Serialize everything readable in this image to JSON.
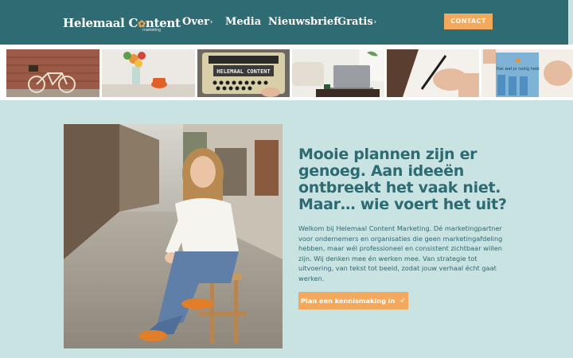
{
  "header": {
    "logo": {
      "text_before": "Helemaal C",
      "flower_glyph": "✿",
      "text_after": "ntent",
      "subtitle": "marketing"
    },
    "nav": [
      {
        "label": "Over",
        "has_dropdown": true,
        "icon": "chevron-down-icon"
      },
      {
        "label": "Media",
        "has_dropdown": false
      },
      {
        "label": "Nieuwsbrief",
        "has_dropdown": false
      },
      {
        "label": "Gratis",
        "has_dropdown": true,
        "icon": "chevron-down-icon"
      }
    ],
    "contact_label": "CONTACT"
  },
  "strip": {
    "images": [
      "bicycle-photo",
      "flowers-phone-photo",
      "typewriter-photo",
      "laptop-photo",
      "writing-hand-photo",
      "brochure-photo"
    ],
    "typewriter_text": "HELEMAAL CONTENT",
    "brochure_text": "Pak wat je nodig hebt"
  },
  "hero": {
    "image": "woman-on-stool-in-street-photo",
    "title": "Mooie plannen zijn er genoeg. Aan ideeën ontbreekt het vaak niet. Maar… wie voert het uit?",
    "body": "Welkom bij Helemaal Content Marketing. Dé marketingpartner voor ondernemers en organisaties die geen marketingafdeling hebben, maar wél professioneel en consistent zichtbaar willen zijn. Wij denken mee én werken mee. Van strategie tot uitvoering, van tekst tot beeld, zodat jouw verhaal écht gaat werken.",
    "cta_label": "Plan een kennismaking in",
    "cta_icon": "paper-plane-icon"
  },
  "colors": {
    "header_bg": "#2f6b72",
    "page_bg": "#c9e2e2",
    "accent_orange": "#f3a85c",
    "text_teal": "#2c6b72"
  }
}
